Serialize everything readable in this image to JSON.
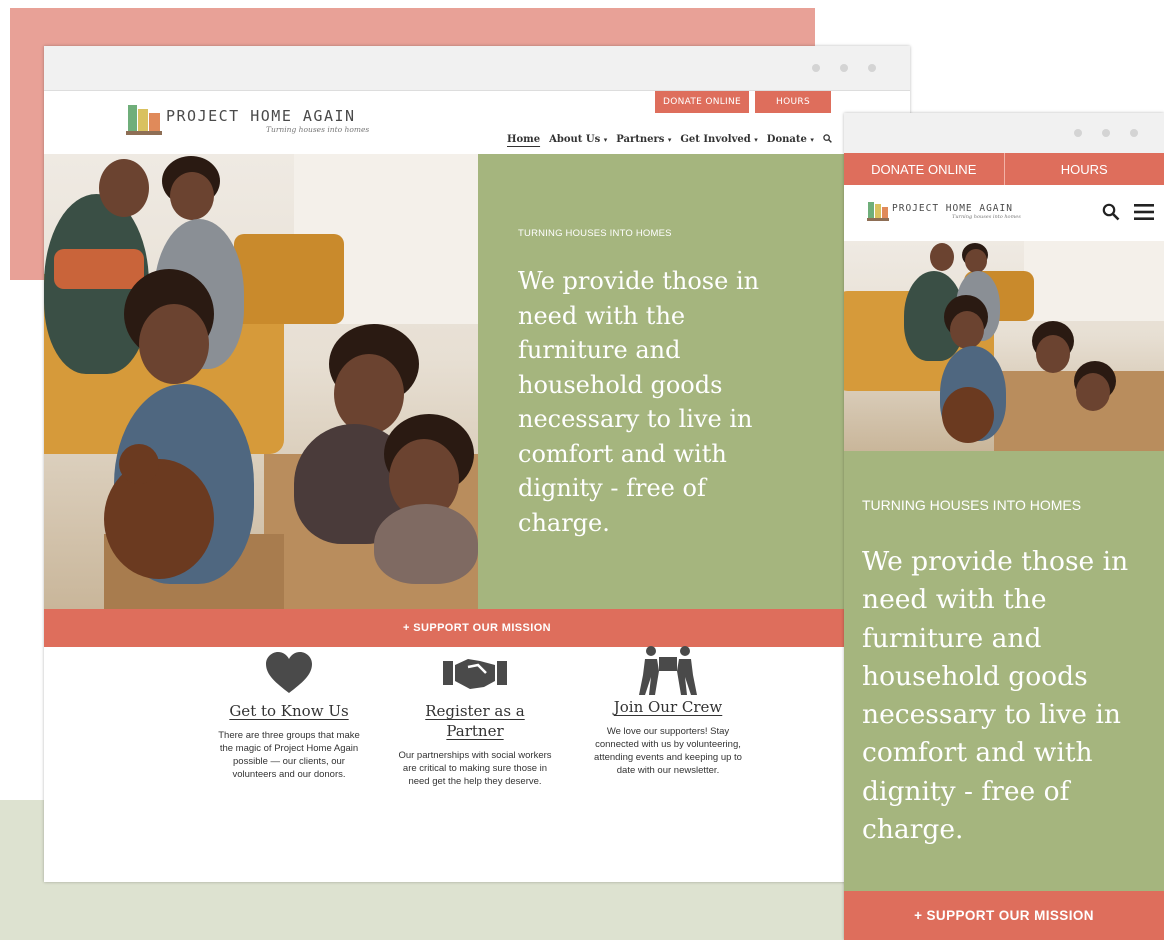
{
  "site": {
    "logo_text": "PROJECT HOME AGAIN",
    "tagline": "Turning houses into homes"
  },
  "header": {
    "donate_label": "DONATE ONLINE",
    "hours_label": "HOURS"
  },
  "nav": {
    "items": [
      {
        "label": "Home",
        "dropdown": false,
        "active": true
      },
      {
        "label": "About Us",
        "dropdown": true
      },
      {
        "label": "Partners",
        "dropdown": true
      },
      {
        "label": "Get Involved",
        "dropdown": true
      },
      {
        "label": "Donate",
        "dropdown": true
      }
    ],
    "search_icon": "search-icon",
    "caret": "▾"
  },
  "hero": {
    "eyebrow": "TURNING HOUSES INTO HOMES",
    "headline": "We provide those in need with the furniture and household goods necessary to live in comfort and with dignity - free of charge."
  },
  "support": {
    "label": "+ SUPPORT OUR MISSION"
  },
  "features": [
    {
      "icon": "heart-icon",
      "title": "Get to Know Us",
      "text": "There are three groups that make the magic of Project Home Again possible — our clients, our volunteers and our donors."
    },
    {
      "icon": "handshake-icon",
      "title": "Register as a Partner",
      "text": "Our partnerships with social workers are critical to making sure those in need get the help they deserve."
    },
    {
      "icon": "movers-icon",
      "title": "Join Our Crew",
      "text": "We love our supporters! Stay connected with us by volunteering, attending events and keeping up to date with our newsletter."
    }
  ],
  "mobile": {
    "search_icon": "search-icon",
    "menu_icon": "hamburger-menu-icon"
  },
  "colors": {
    "accent": "#de6e5c",
    "green_panel": "#a5b57e",
    "pink_bg": "#e8a197",
    "sage_bg": "#dde2d0"
  }
}
